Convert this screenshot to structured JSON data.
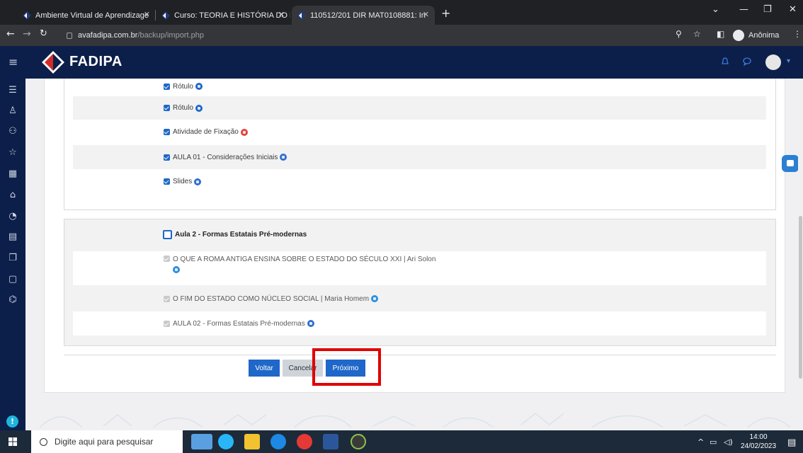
{
  "browser": {
    "tabs": [
      {
        "title": "Ambiente Virtual de Aprendizage",
        "active": false
      },
      {
        "title": "Curso: TEORIA E HISTÓRIA DO D",
        "active": false
      },
      {
        "title": "110512/201 DIR MAT0108881: In",
        "active": true
      }
    ],
    "url_host": "avafadipa.com.br",
    "url_path": "/backup/import.php",
    "profile_label": "Anônima"
  },
  "site": {
    "brand": "FADIPA",
    "accent": "#0c1f4a",
    "primary": "#1f67c8"
  },
  "section1": {
    "items": [
      {
        "label": "Rótulo",
        "icon": "label-icon",
        "checked": true
      },
      {
        "label": "Rótulo",
        "icon": "label-icon",
        "checked": true
      },
      {
        "label": "Atividade de Fixação",
        "icon": "quiz-icon",
        "checked": true
      },
      {
        "label": "AULA 01 - Considerações Iniciais",
        "icon": "page-icon",
        "checked": true
      },
      {
        "label": "Slides",
        "icon": "page-icon",
        "checked": true
      }
    ]
  },
  "section2": {
    "title": "Aula 2 - Formas Estatais Pré-modernas",
    "checked": false,
    "items": [
      {
        "label": "O QUE A ROMA ANTIGA ENSINA SOBRE O ESTADO DO SÉCULO XXI | Ari Solon",
        "icon": "url-icon",
        "checked": true,
        "disabled": true
      },
      {
        "label": "O FIM DO ESTADO COMO NÚCLEO SOCIAL | Maria Homem",
        "icon": "url-icon",
        "checked": true,
        "disabled": true
      },
      {
        "label": "AULA 02 - Formas Estatais Pré-modernas",
        "icon": "page-icon",
        "checked": true,
        "disabled": true
      }
    ]
  },
  "buttons": {
    "back": "Voltar",
    "cancel": "Cancelar",
    "next": "Próximo"
  },
  "taskbar": {
    "search_placeholder": "Digite aqui para pesquisar",
    "time": "14:00",
    "date": "24/02/2023"
  }
}
